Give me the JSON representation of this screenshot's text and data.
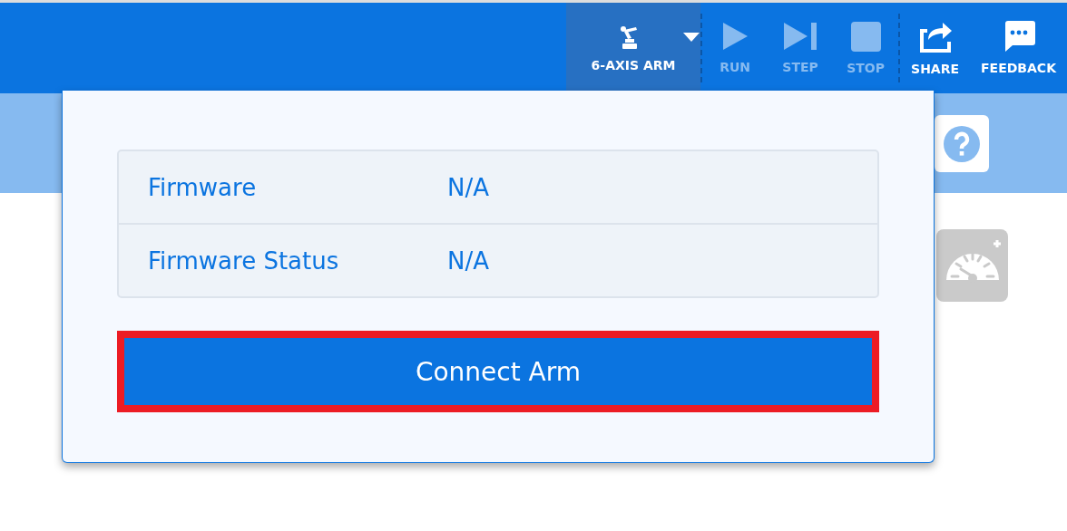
{
  "toolbar": {
    "robot_selector": {
      "label": "6-AXIS ARM"
    },
    "run_controls": [
      {
        "kind": "run",
        "label": "RUN",
        "disabled": true
      },
      {
        "kind": "step",
        "label": "STEP",
        "disabled": true
      },
      {
        "kind": "stop",
        "label": "STOP",
        "disabled": true
      }
    ],
    "actions": [
      {
        "kind": "share",
        "label": "SHARE"
      },
      {
        "kind": "feedback",
        "label": "FEEDBACK"
      }
    ]
  },
  "connection_panel": {
    "info": [
      {
        "label": "Firmware",
        "value": "N/A"
      },
      {
        "label": "Firmware Status",
        "value": "N/A"
      }
    ],
    "connect_button": {
      "label": "Connect Arm",
      "highlighted": true
    }
  }
}
